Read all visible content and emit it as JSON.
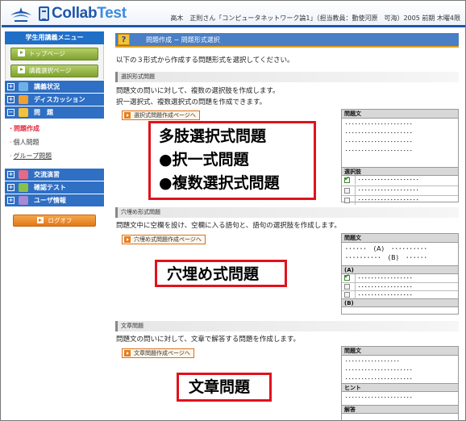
{
  "header": {
    "logo_text_main": "Collab",
    "logo_text_accent": "Test",
    "info": "高木　正則さん「コンピュータネットワーク論1」（担当教員：動使河原　可海）2005 前期 木曜4限"
  },
  "sidebar": {
    "title": "学生用講義メニュー",
    "top_button": "トップページ",
    "lecture_select_button": "講義選択ページ",
    "menu": [
      {
        "label": "講義状況",
        "toggle": "+"
      },
      {
        "label": "ディスカッション",
        "toggle": "+"
      },
      {
        "label": "問　題",
        "toggle": "−"
      }
    ],
    "submenu": [
      {
        "label": "問題作成",
        "active": true
      },
      {
        "label": "個人問題",
        "active": false
      },
      {
        "label": "グループ問題",
        "active": false
      }
    ],
    "menu2": [
      {
        "label": "交流演習",
        "toggle": "+"
      },
      {
        "label": "確認テスト",
        "toggle": "+"
      },
      {
        "label": "ユーザ情報",
        "toggle": "+"
      }
    ],
    "logoff_button": "ログオフ"
  },
  "main": {
    "title": "問題作成 − 問題形式選択",
    "intro": "以下の３形式から作成する問題形式を選択してください。",
    "sections": [
      {
        "header": "選択形式問題",
        "desc": [
          "問題文の問いに対して、複数の選択肢を作成します。",
          "択一選択式、複数選択式の問題を作成できます。"
        ],
        "button": "選択式問題作成ページへ"
      },
      {
        "header": "穴埋め形式問題",
        "desc": [
          "問題文中に空欄を設け、空欄に入る語句と、語句の選択肢を作成します。"
        ],
        "button": "穴埋め式問題作成ページへ"
      },
      {
        "header": "文章問題",
        "desc": [
          "問題文の問いに対して、文章で解答する問題を作成します。"
        ],
        "button": "文章問題作成ページへ"
      }
    ]
  },
  "callouts": {
    "multiple_choice": [
      "多肢選択式問題",
      "●択一式問題",
      "●複数選択式問題"
    ],
    "fill_in": "穴埋め式問題",
    "essay": "文章問題"
  },
  "samples": {
    "mc": {
      "question_header": "問題文",
      "question_lines": [
        "･････････････････････",
        "･････････････････････",
        "･････････････････････",
        "･････････････････････"
      ],
      "choices_header": "選択肢",
      "choices": [
        {
          "text": "･･･････････････････",
          "checked": true
        },
        {
          "text": "･･･････････････････",
          "checked": false
        },
        {
          "text": "･･･････････････････",
          "checked": false
        }
      ]
    },
    "fill": {
      "question_header": "問題文",
      "question_lines": [
        "･･････　(A)　･･････････",
        "･･････････　(B)　･･････"
      ],
      "a_label": "(A)",
      "a_choices": [
        {
          "text": "･････････････････",
          "checked": true
        },
        {
          "text": "･････････････････",
          "checked": false
        },
        {
          "text": "･････････････････",
          "checked": false
        }
      ],
      "b_label": "(B)",
      "b_choices": [
        {
          "text": "･････････････････",
          "checked": true
        }
      ]
    },
    "essay": {
      "question_header": "問題文",
      "question_lines": [
        "･････････････････",
        "･････････････････････",
        "･････････････････････"
      ],
      "hint_header": "ヒント",
      "hint_lines": [
        "･････････････････････"
      ],
      "answer_header": "解答"
    }
  },
  "colors": {
    "brand_blue": "#1f57a8",
    "menu_blue": "#2f6fc4",
    "callout_red": "#e0121d",
    "active_red": "#e0283a"
  }
}
